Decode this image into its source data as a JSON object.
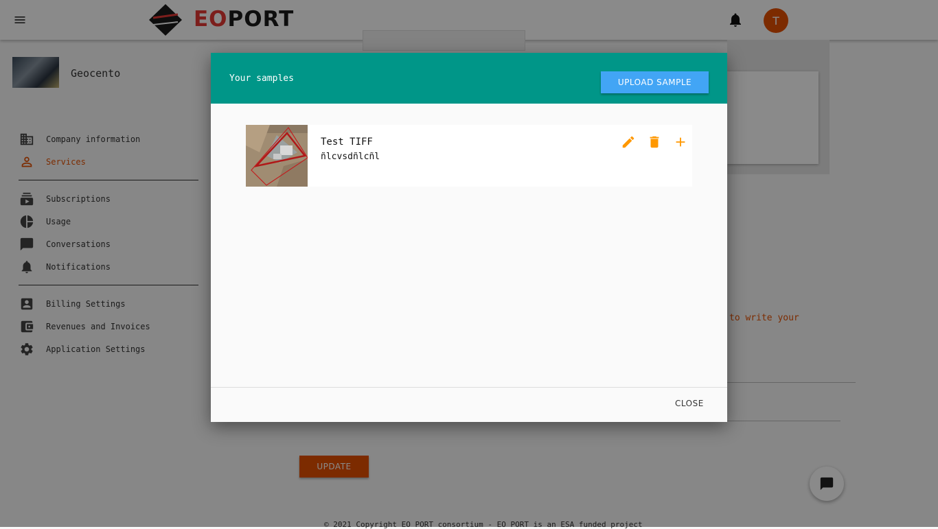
{
  "header": {
    "brand": {
      "prefix": "EO",
      "suffix": "PORT"
    },
    "avatar_initial": "T"
  },
  "company": {
    "name": "Geocento"
  },
  "sidebar": {
    "items": [
      {
        "label": "Company information",
        "icon": "building-icon"
      },
      {
        "label": "Services",
        "icon": "person-icon",
        "active": true
      },
      {
        "label": "Subscriptions",
        "icon": "subscriptions-icon"
      },
      {
        "label": "Usage",
        "icon": "pie-chart-icon"
      },
      {
        "label": "Conversations",
        "icon": "chat-icon"
      },
      {
        "label": "Notifications",
        "icon": "bell-icon"
      },
      {
        "label": "Billing Settings",
        "icon": "contact-card-icon"
      },
      {
        "label": "Revenues and Invoices",
        "icon": "wallet-icon"
      },
      {
        "label": "Application Settings",
        "icon": "gear-icon"
      }
    ]
  },
  "background": {
    "hint_text": "to write your",
    "update_label": "UPDATE",
    "footer_text": "© 2021 Copyright EO PORT consortium - EO PORT is an ESA funded project"
  },
  "dialog": {
    "title": "Your samples",
    "upload_label": "UPLOAD SAMPLE",
    "close_label": "CLOSE",
    "samples": [
      {
        "title": "Test TIFF",
        "description": "ñlcvsdñlcñl"
      }
    ]
  },
  "colors": {
    "accent": "#e65100",
    "dialog_header": "#009688",
    "upload_button": "#42a5f5",
    "action_icons": "#ff9800"
  }
}
